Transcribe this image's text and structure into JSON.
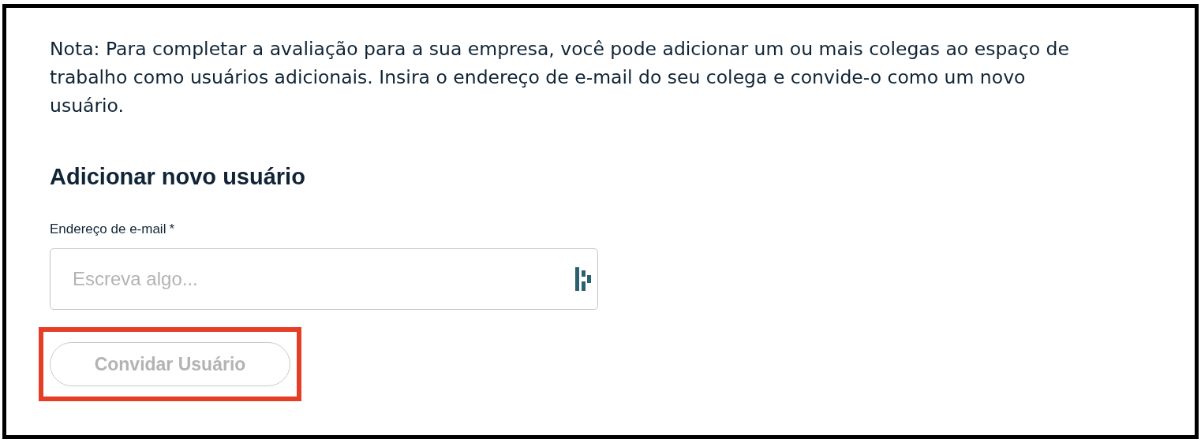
{
  "note": "Nota: Para completar a avaliação para a sua empresa, você pode adicionar um ou mais colegas ao espaço de trabalho como usuários adicionais. Insira o endereço de e-mail do seu colega e convide-o como um novo usuário.",
  "heading": "Adicionar novo usuário",
  "email_field": {
    "label": "Endereço de e-mail",
    "required_mark": "*",
    "placeholder": "Escreva algo..."
  },
  "invite_button": {
    "label": "Convidar Usuário",
    "disabled": true,
    "highlighted": true
  }
}
